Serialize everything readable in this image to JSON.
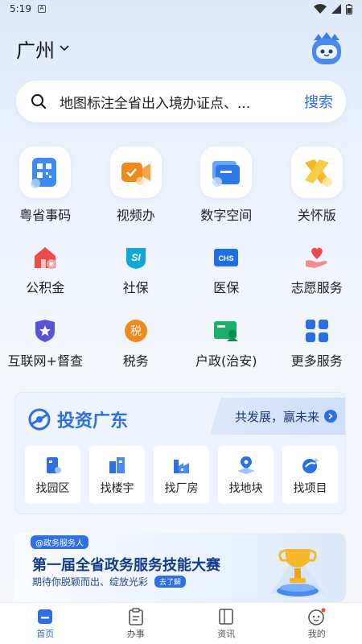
{
  "status": {
    "time": "5:19",
    "app_icon": "A"
  },
  "header": {
    "city": "广州"
  },
  "search": {
    "placeholder": "地图标注全省出入境办证点、...",
    "button": "搜索"
  },
  "featured": [
    {
      "label": "粤省事码",
      "icon": "qr-code-icon"
    },
    {
      "label": "视频办",
      "icon": "video-icon"
    },
    {
      "label": "数字空间",
      "icon": "folder-icon"
    },
    {
      "label": "关怀版",
      "icon": "care-ribbon-icon"
    }
  ],
  "services_row1": [
    {
      "label": "公积金",
      "icon": "house-fund-icon"
    },
    {
      "label": "社保",
      "icon": "social-security-icon",
      "glyph": "SI"
    },
    {
      "label": "医保",
      "icon": "medical-insurance-icon",
      "glyph": "CHS"
    },
    {
      "label": "志愿服务",
      "icon": "volunteer-icon"
    }
  ],
  "services_row2": [
    {
      "label": "互联网+督查",
      "icon": "shield-star-icon"
    },
    {
      "label": "税务",
      "icon": "tax-icon",
      "glyph": "税"
    },
    {
      "label": "户政(治安)",
      "icon": "household-icon"
    },
    {
      "label": "更多服务",
      "icon": "more-grid-icon"
    }
  ],
  "invest": {
    "title": "投资广东",
    "slogan": "共发展，赢未来",
    "items": [
      {
        "label": "找园区",
        "icon": "park-icon"
      },
      {
        "label": "找楼宇",
        "icon": "building-icon"
      },
      {
        "label": "找厂房",
        "icon": "factory-icon"
      },
      {
        "label": "找地块",
        "icon": "land-icon"
      },
      {
        "label": "找项目",
        "icon": "project-icon"
      }
    ]
  },
  "banner": {
    "tag": "@政务服务人",
    "title": "第一届全省政务服务技能大赛",
    "subtitle": "期待你脱颖而出、绽放光彩",
    "more": "去了解"
  },
  "tabs": [
    {
      "label": "首页",
      "icon": "home-icon",
      "active": true
    },
    {
      "label": "办事",
      "icon": "clipboard-icon",
      "active": false
    },
    {
      "label": "资讯",
      "icon": "news-icon",
      "active": false
    },
    {
      "label": "我的",
      "icon": "profile-icon",
      "active": false
    }
  ],
  "colors": {
    "accent": "#2a6fe6",
    "orange": "#f08a1c",
    "red": "#ea4b4b"
  }
}
